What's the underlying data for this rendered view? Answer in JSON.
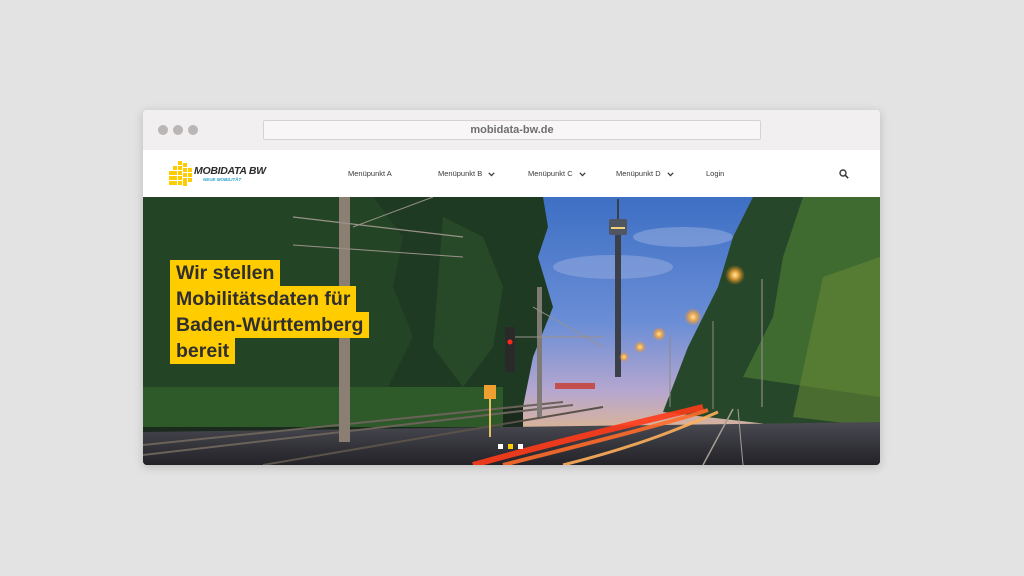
{
  "browser": {
    "url": "mobidata-bw.de"
  },
  "logo": {
    "text": "MOBIDATA BW",
    "subtitle": "NEUE MOBILITÄT"
  },
  "nav": {
    "items": [
      {
        "label": "Menüpunkt A",
        "dropdown": false
      },
      {
        "label": "Menüpunkt B",
        "dropdown": true
      },
      {
        "label": "Menüpunkt C",
        "dropdown": true
      },
      {
        "label": "Menüpunkt D",
        "dropdown": true
      },
      {
        "label": "Login",
        "dropdown": false
      }
    ]
  },
  "hero": {
    "headline_lines": [
      "Wir stellen",
      "Mobilitätsdaten für",
      "Baden-Württemberg",
      "bereit"
    ],
    "slider": {
      "slide_count": 3,
      "active_index": 1
    }
  },
  "colors": {
    "accent": "#ffcc00",
    "text": "#2f2f2f",
    "logo_blue": "#2aa1c8"
  },
  "icons": {
    "search": "search-icon",
    "chevron": "chevron-down-icon"
  }
}
